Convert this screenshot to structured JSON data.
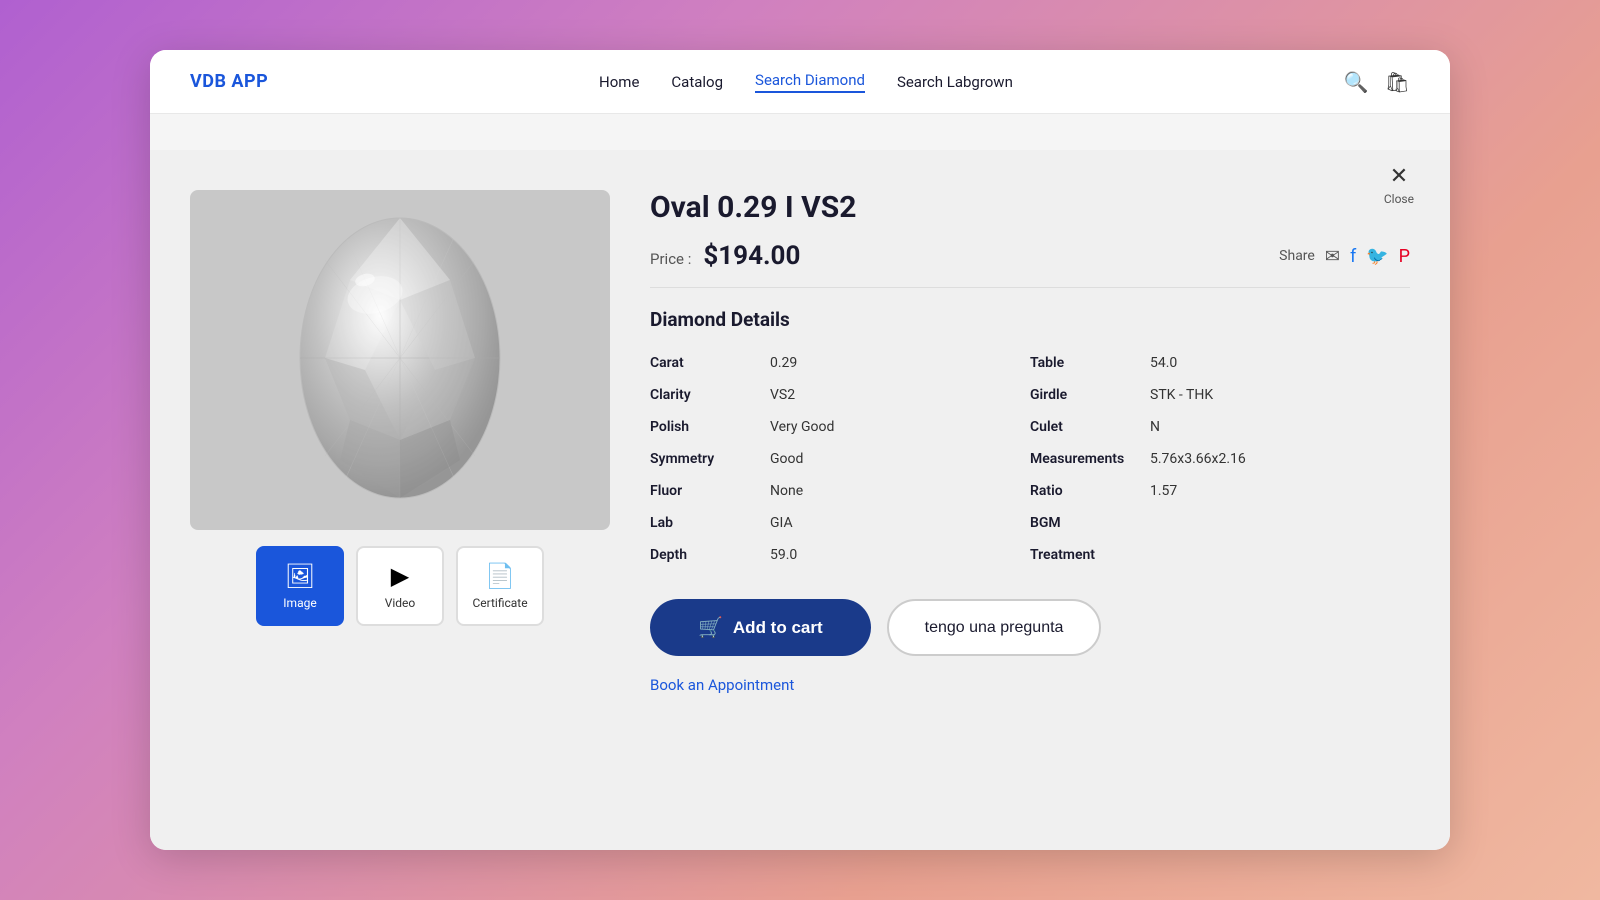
{
  "app": {
    "logo": "VDB APP"
  },
  "nav": {
    "items": [
      {
        "label": "Home",
        "active": false
      },
      {
        "label": "Catalog",
        "active": false
      },
      {
        "label": "Search Diamond",
        "active": true
      },
      {
        "label": "Search Labgrown",
        "active": false
      }
    ]
  },
  "close": {
    "label": "Close"
  },
  "product": {
    "title": "Oval 0.29 I VS2",
    "price_label": "Price :",
    "price": "$194.00",
    "share_label": "Share",
    "details_title": "Diamond Details",
    "details_left": [
      {
        "key": "Carat",
        "value": "0.29"
      },
      {
        "key": "Clarity",
        "value": "VS2"
      },
      {
        "key": "Polish",
        "value": "Very Good"
      },
      {
        "key": "Symmetry",
        "value": "Good"
      },
      {
        "key": "Fluor",
        "value": "None"
      },
      {
        "key": "Lab",
        "value": "GIA"
      },
      {
        "key": "Depth",
        "value": "59.0"
      }
    ],
    "details_right": [
      {
        "key": "Table",
        "value": "54.0"
      },
      {
        "key": "Girdle",
        "value": "STK - THK"
      },
      {
        "key": "Culet",
        "value": "N"
      },
      {
        "key": "Measurements",
        "value": "5.76x3.66x2.16"
      },
      {
        "key": "Ratio",
        "value": "1.57"
      },
      {
        "key": "BGM",
        "value": ""
      },
      {
        "key": "Treatment",
        "value": ""
      }
    ],
    "add_to_cart_label": "Add to cart",
    "question_label": "tengo una pregunta",
    "appointment_label": "Book an Appointment"
  },
  "media_tabs": [
    {
      "label": "Image",
      "active": true,
      "icon": "🖼"
    },
    {
      "label": "Video",
      "active": false,
      "icon": "▶"
    },
    {
      "label": "Certificate",
      "active": false,
      "icon": "📄"
    }
  ]
}
